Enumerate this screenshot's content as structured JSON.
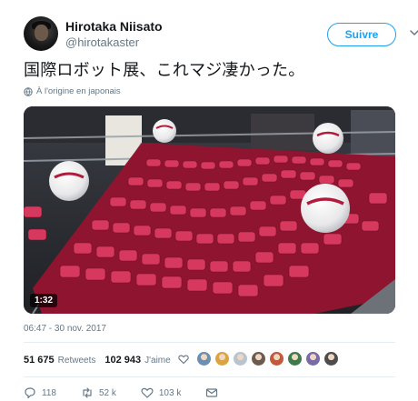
{
  "author": {
    "name": "Hirotaka Niisato",
    "handle": "@hirotakaster"
  },
  "follow_label": "Suivre",
  "tweet": {
    "text": "国際ロボット展、これマジ凄かった。",
    "translation_note": "À l'origine en japonais",
    "video_duration": "1:32",
    "timestamp": "06:47 - 30 nov. 2017"
  },
  "stats": {
    "retweets_count": "51 675",
    "retweets_label": "Retweets",
    "likes_count": "102 943",
    "likes_label": "J'aime"
  },
  "liker_avatars": [
    "#6a8fb0",
    "#d9a441",
    "#b8c4cf",
    "#6c5b4f",
    "#c25a3c",
    "#3f7a4a",
    "#7a6aa8",
    "#4d4d4d"
  ],
  "actions": {
    "reply_count": "118",
    "retweet_count": "52 k",
    "like_count": "103 k"
  },
  "colors": {
    "accent": "#1da1f2",
    "muted": "#657786",
    "text": "#14171a",
    "divider": "#e6ecf0"
  },
  "icons": [
    "globe-icon",
    "chevron-down-icon",
    "heart-icon",
    "reply-icon",
    "retweet-icon",
    "mail-icon"
  ]
}
